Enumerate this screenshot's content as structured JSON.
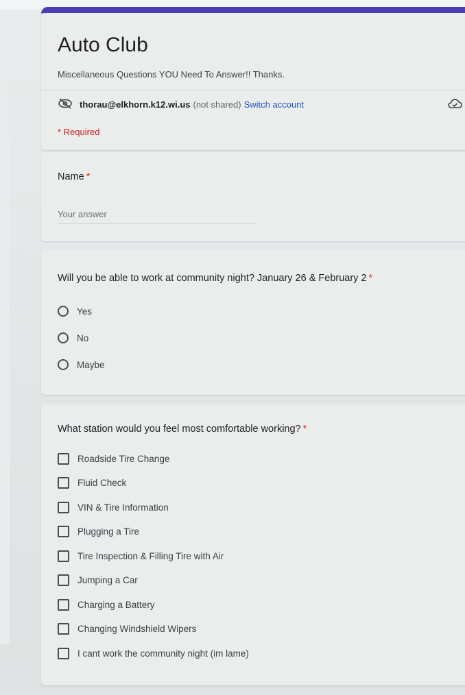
{
  "form": {
    "title": "Auto Club",
    "description": "Miscellaneous Questions YOU Need To Answer!! Thanks.",
    "email": "thorau@elkhorn.k12.wi.us",
    "not_shared": "(not shared)",
    "switch_account": "Switch account",
    "required_note": "* Required",
    "accent_color": "#4b3fb0"
  },
  "q1": {
    "label": "Name",
    "required_marker": "*",
    "placeholder": "Your answer"
  },
  "q2": {
    "label": "Will you be able to work at community night? January 26 & February 2",
    "required_marker": "*",
    "options": [
      "Yes",
      "No",
      "Maybe"
    ]
  },
  "q3": {
    "label": "What station would you feel most comfortable working?",
    "required_marker": "*",
    "options": [
      "Roadside Tire Change",
      "Fluid Check",
      "VIN & Tire Information",
      "Plugging a Tire",
      "Tire Inspection & Filling Tire with Air",
      "Jumping a Car",
      "Charging a Battery",
      "Changing Windshield Wipers",
      "I cant work the community night (im lame)"
    ]
  },
  "icons": {
    "account_visibility": "eye-off-icon",
    "cloud": "cloud-icon"
  }
}
